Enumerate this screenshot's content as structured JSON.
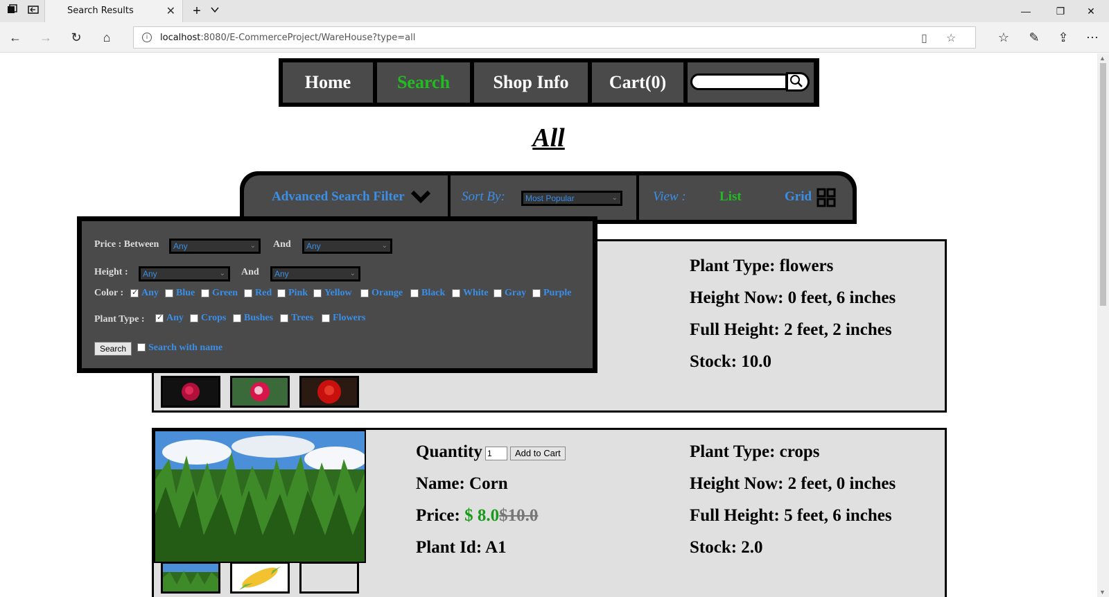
{
  "browser": {
    "tab_title": "Search Results",
    "url_host": "localhost",
    "url_rest": ":8080/E-CommerceProject/WareHouse?type=all"
  },
  "nav": {
    "items": [
      "Home",
      "Search",
      "Shop Info",
      "Cart(0)"
    ],
    "active": "Search"
  },
  "page_title": "All",
  "filterbar": {
    "advanced_label": "Advanced Search Filter",
    "sort_label": "Sort By:",
    "sort_value": "Most Popular",
    "view_label": "View :",
    "list_label": "List",
    "grid_label": "Grid"
  },
  "advanced": {
    "price_label": "Price : Between",
    "price_from": "Any",
    "and1": "And",
    "price_to": "Any",
    "height_label": "Height :",
    "height_from": "Any",
    "and2": "And",
    "height_to": "Any",
    "color_label": "Color :",
    "colors": [
      {
        "label": "Any",
        "checked": true
      },
      {
        "label": "Blue",
        "checked": false
      },
      {
        "label": "Green",
        "checked": false
      },
      {
        "label": "Red",
        "checked": false
      },
      {
        "label": "Pink",
        "checked": false
      },
      {
        "label": "Yellow",
        "checked": false
      },
      {
        "label": "Orange",
        "checked": false
      },
      {
        "label": "Black",
        "checked": false
      },
      {
        "label": "White",
        "checked": false
      },
      {
        "label": "Gray",
        "checked": false
      },
      {
        "label": "Purple",
        "checked": false
      }
    ],
    "plant_type_label": "Plant Type :",
    "plant_types": [
      {
        "label": "Any",
        "checked": true
      },
      {
        "label": "Crops",
        "checked": false
      },
      {
        "label": "Bushes",
        "checked": false
      },
      {
        "label": "Trees",
        "checked": false
      },
      {
        "label": "Flowers",
        "checked": false
      }
    ],
    "search_button": "Search",
    "search_with_name": "Search with name"
  },
  "products": [
    {
      "plant_type": "Plant Type: flowers",
      "height_now": "Height Now: 0 feet, 6 inches",
      "full_height": "Full Height: 2 feet, 2 inches",
      "stock": "Stock: 10.0"
    },
    {
      "quantity_label": "Quantity",
      "quantity_value": "1",
      "add_to_cart": "Add to Cart",
      "name": "Name: Corn",
      "price_label": "Price:",
      "price_now": "$ 8.0",
      "price_old": "$10.0",
      "plant_id": "Plant Id: A1",
      "plant_type": "Plant Type: crops",
      "height_now": "Height Now: 2 feet, 0 inches",
      "full_height": "Full Height: 5 feet, 6 inches",
      "stock": "Stock: 2.0"
    }
  ]
}
